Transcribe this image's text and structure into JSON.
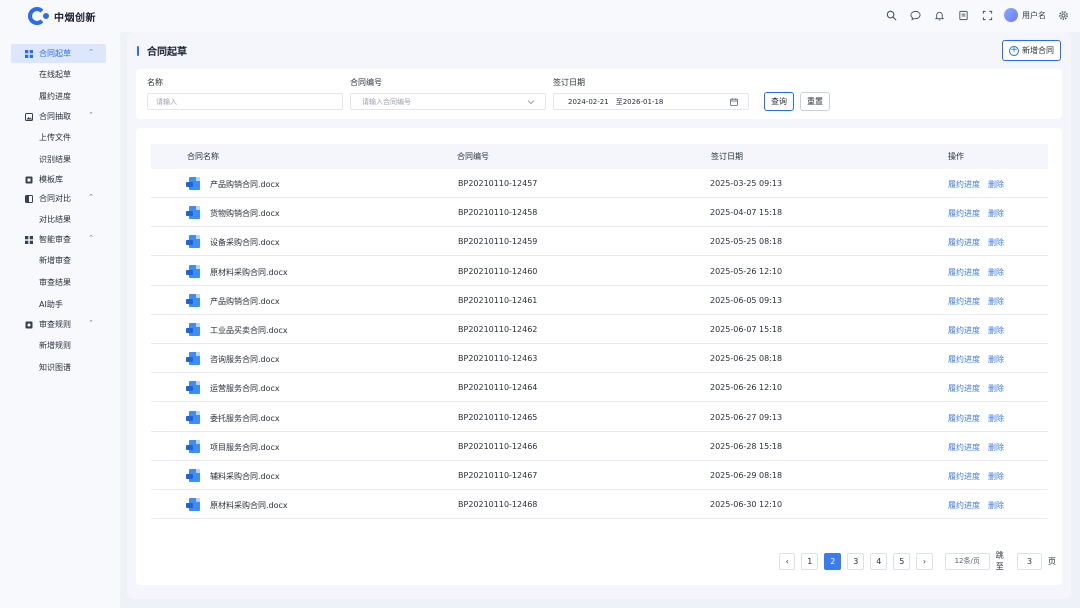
{
  "app": {
    "name": "中烟创新"
  },
  "header": {
    "user_name": "用户名"
  },
  "sidebar": {
    "groups": [
      {
        "label": "合同起草",
        "icon": "grid-icon",
        "active": true,
        "expandable": true,
        "items": [
          {
            "label": "在线起草"
          },
          {
            "label": "履约进度"
          }
        ]
      },
      {
        "label": "合同抽取",
        "icon": "image-icon",
        "expandable": true,
        "items": [
          {
            "label": "上传文件"
          },
          {
            "label": "识别结果"
          }
        ]
      },
      {
        "label": "模板库",
        "icon": "square-icon",
        "expandable": false,
        "items": []
      },
      {
        "label": "合同对比",
        "icon": "compare-icon",
        "expandable": true,
        "items": [
          {
            "label": "对比结果"
          }
        ]
      },
      {
        "label": "智能审查",
        "icon": "grid-icon",
        "expandable": true,
        "items": [
          {
            "label": "新增审查"
          },
          {
            "label": "审查结果"
          },
          {
            "label": "AI助手"
          }
        ]
      },
      {
        "label": "审查规则",
        "icon": "settings-icon",
        "expandable": true,
        "items": [
          {
            "label": "新增规则"
          },
          {
            "label": "知识图谱"
          }
        ]
      }
    ]
  },
  "page": {
    "title": "合同起草",
    "add_label": "新增合同"
  },
  "filters": {
    "name_label": "名称",
    "name_placeholder": "请输入",
    "code_label": "合同编号",
    "code_placeholder": "请输入合同编号",
    "date_label": "签订日期",
    "date_start": "2024-02-21",
    "date_sep": "至",
    "date_end": "2026-01-18",
    "query_label": "查询",
    "reset_label": "重置"
  },
  "table": {
    "headers": {
      "name": "合同名称",
      "code": "合同编号",
      "date": "签订日期",
      "ops": "操作"
    },
    "op_progress": "履约进度",
    "op_delete": "删除",
    "rows": [
      {
        "name": "产品购销合同.docx",
        "code": "BP20210110-12457",
        "date": "2025-03-25  09:13"
      },
      {
        "name": "货物购销合同.docx",
        "code": "BP20210110-12458",
        "date": "2025-04-07  15:18"
      },
      {
        "name": "设备采购合同.docx",
        "code": "BP20210110-12459",
        "date": "2025-05-25  08:18"
      },
      {
        "name": "原材料采购合同.docx",
        "code": "BP20210110-12460",
        "date": "2025-05-26  12:10"
      },
      {
        "name": "产品购销合同.docx",
        "code": "BP20210110-12461",
        "date": "2025-06-05  09:13"
      },
      {
        "name": "工业品买卖合同.docx",
        "code": "BP20210110-12462",
        "date": "2025-06-07  15:18"
      },
      {
        "name": "咨询服务合同.docx",
        "code": "BP20210110-12463",
        "date": "2025-06-25  08:18"
      },
      {
        "name": "运营服务合同.docx",
        "code": "BP20210110-12464",
        "date": "2025-06-26  12:10"
      },
      {
        "name": "委托服务合同.docx",
        "code": "BP20210110-12465",
        "date": "2025-06-27  09:13"
      },
      {
        "name": "项目服务合同.docx",
        "code": "BP20210110-12466",
        "date": "2025-06-28  15:18"
      },
      {
        "name": "辅料采购合同.docx",
        "code": "BP20210110-12467",
        "date": "2025-06-29  08:18"
      },
      {
        "name": "原材料采购合同.docx",
        "code": "BP20210110-12468",
        "date": "2025-06-30  12:10"
      }
    ]
  },
  "pagination": {
    "pages": [
      "1",
      "2",
      "3",
      "4",
      "5"
    ],
    "current": "2",
    "page_size": "12条/页",
    "jump_label": "跳至",
    "jump_value": "3",
    "page_unit": "页"
  },
  "colors": {
    "accent": "#2a6cf0",
    "link": "#3b7bf0",
    "sidebar_active_bg": "#dde7fb"
  }
}
